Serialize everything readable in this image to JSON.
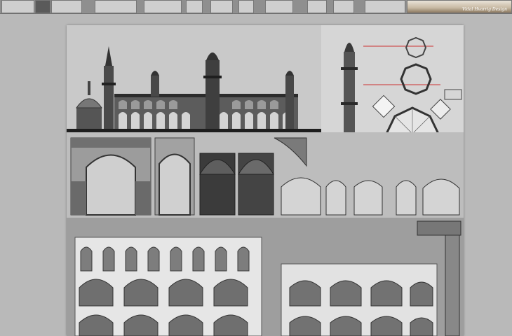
{
  "thumbnail_strip": {
    "thumbnails": [
      {
        "id": "sheet-1"
      },
      {
        "id": "sheet-2"
      },
      {
        "id": "sheet-3"
      },
      {
        "id": "sheet-4"
      },
      {
        "id": "sheet-5"
      },
      {
        "id": "sheet-6"
      },
      {
        "id": "sheet-7"
      },
      {
        "id": "sheet-8"
      },
      {
        "id": "sheet-9"
      },
      {
        "id": "sheet-10"
      },
      {
        "id": "sheet-11"
      },
      {
        "id": "sheet-12"
      },
      {
        "id": "sheet-13"
      }
    ],
    "photo_caption": "Vidal Hvarrig Design"
  },
  "sheet": {
    "background": "#a8a8a8",
    "panels": [
      {
        "name": "palace-elevation"
      },
      {
        "name": "minaret-plans"
      },
      {
        "name": "arch-details"
      },
      {
        "name": "arcade-facades"
      }
    ],
    "colors": {
      "ink": "#2d2d2d",
      "stone": "#8a8a8a",
      "plan_guides": "#cc3333"
    }
  }
}
